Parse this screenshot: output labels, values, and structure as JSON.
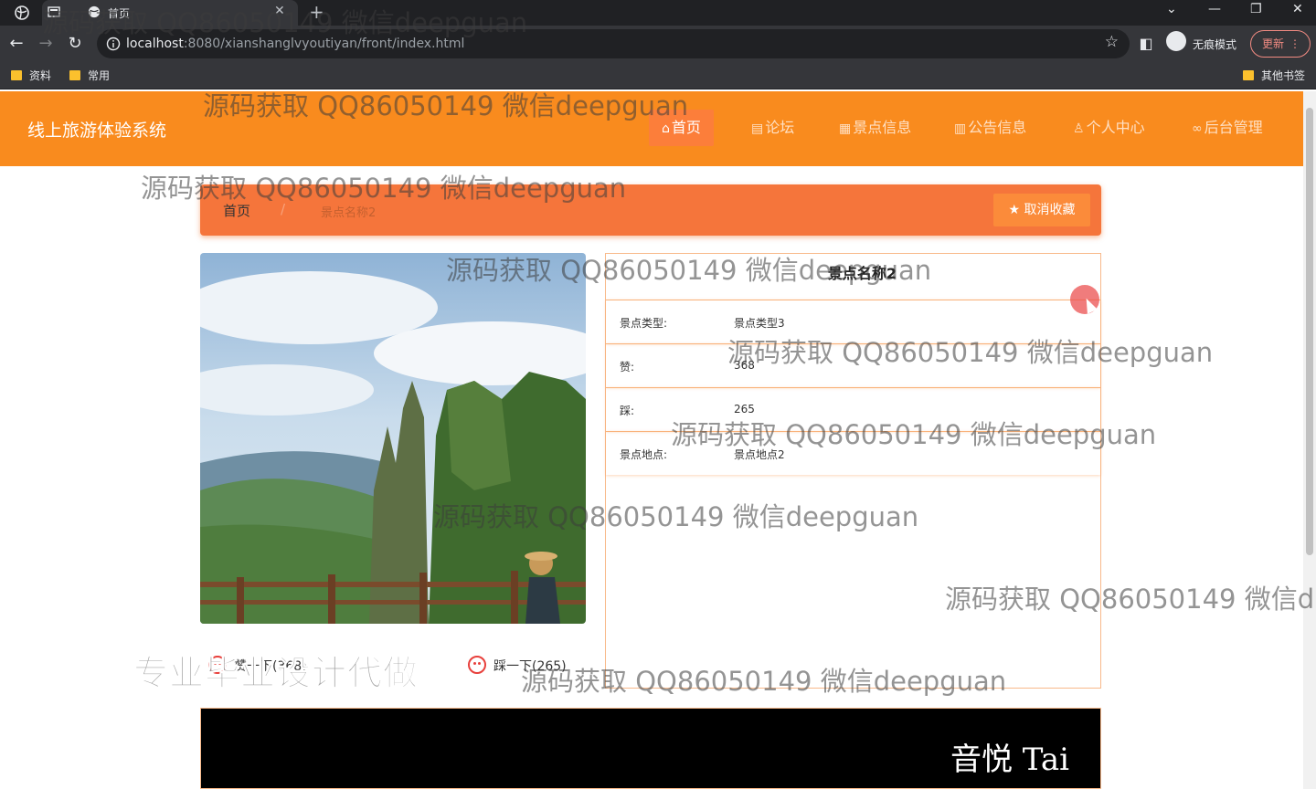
{
  "browser": {
    "tab_title": "首页",
    "url_host": "localhost",
    "url_rest": ":8080/xianshanglvyoutiyan/front/index.html",
    "incognito_label": "无痕模式",
    "update_label": "更新",
    "bookmarks": [
      "资料",
      "常用"
    ],
    "other_bookmarks": "其他书签"
  },
  "site": {
    "title": "线上旅游体验系统",
    "menu": [
      {
        "icon": "home-icon",
        "label": "首页",
        "active": true
      },
      {
        "icon": "forum-icon",
        "label": "论坛"
      },
      {
        "icon": "scenic-icon",
        "label": "景点信息"
      },
      {
        "icon": "notice-icon",
        "label": "公告信息"
      },
      {
        "icon": "user-icon",
        "label": "个人中心"
      },
      {
        "icon": "link-icon",
        "label": "后台管理"
      }
    ]
  },
  "breadcrumb": {
    "home": "首页",
    "separator": "/",
    "current": "景点名称2",
    "favorite_button": "取消收藏"
  },
  "detail": {
    "title": "景点名称2",
    "rows": [
      {
        "key": "景点类型:",
        "value": "景点类型3"
      },
      {
        "key": "赞:",
        "value": "368"
      },
      {
        "key": "踩:",
        "value": "265"
      },
      {
        "key": "景点地点:",
        "value": "景点地点2"
      }
    ]
  },
  "actions": {
    "like": "赞一下(368)",
    "dislike": "踩一下(265)"
  },
  "video": {
    "caption": "音悦 Tai"
  },
  "watermark": {
    "text": "源码获取 QQ86050149 微信deepguan",
    "partial": "源码获取 QQ86050149 微信d",
    "badge": "专业毕业设计代做"
  },
  "colors": {
    "header": "#f98b1e",
    "breadcrumb": "#f5753b",
    "accent": "#fb8b3a"
  }
}
